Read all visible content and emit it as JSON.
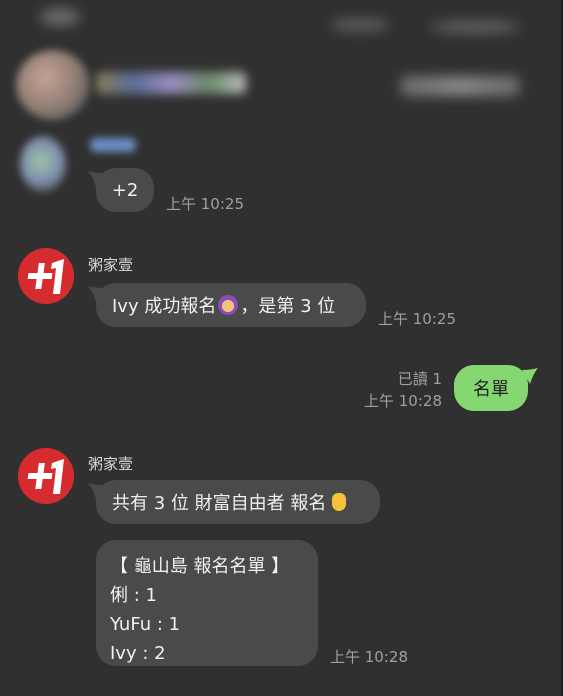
{
  "messages": {
    "plus_two": {
      "text": "+2",
      "time": "上午 10:25"
    },
    "msg1": {
      "sender": "粥家壹",
      "text_before": "Ivy 成功報名 ",
      "text_after": "，是第 3 位",
      "emoji": "woman-supervillain-emoji",
      "time": "上午 10:25"
    },
    "self_msg": {
      "read": "已讀 1",
      "time": "上午 10:28",
      "text": "名單"
    },
    "msg2": {
      "sender": "粥家壹",
      "text": "共有 3 位 財富自由者 報名",
      "emoji": "raised-hand-emoji"
    },
    "list_msg": {
      "lines": [
        "【 龜山島 報名名單 】",
        "俐 : 1",
        "YuFu : 1",
        "Ivy : 2"
      ],
      "time": "上午 10:28"
    }
  },
  "colors": {
    "background": "#303030",
    "bubble_other": "#4a4a4a",
    "bubble_self": "#85d871",
    "avatar_red": "#d62b2f"
  }
}
